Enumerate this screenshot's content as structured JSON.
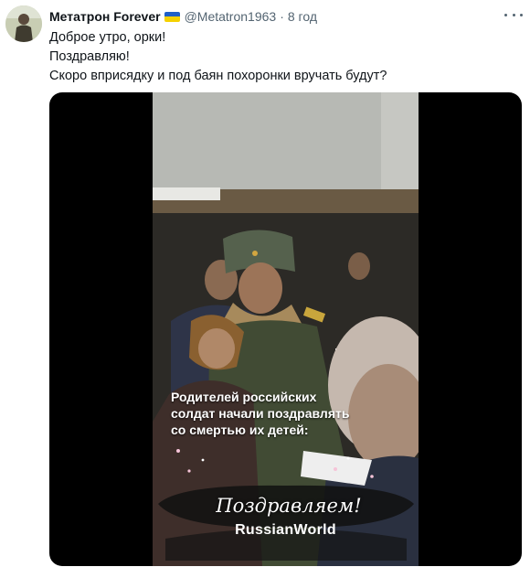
{
  "tweet": {
    "display_name": "Метатрон Forever",
    "handle": "@Metatron1963",
    "separator": "·",
    "time": "8 год",
    "text_lines": [
      "Доброе утро, орки!",
      "Поздравляю!",
      "Скоро вприсядку и под баян похоронки вручать будут?"
    ],
    "flag_colors": [
      "#1f5fc8",
      "#f5d100"
    ]
  },
  "video": {
    "caption_lines": [
      "Родителей российских",
      "солдат начали поздравлять",
      "со смертью их детей:"
    ],
    "banner_text": "Поздравляем!",
    "brand": "RussianWorld"
  },
  "icons": {
    "more": "more-horizontal-icon",
    "verified_flag": "ukraine-flag-icon"
  }
}
